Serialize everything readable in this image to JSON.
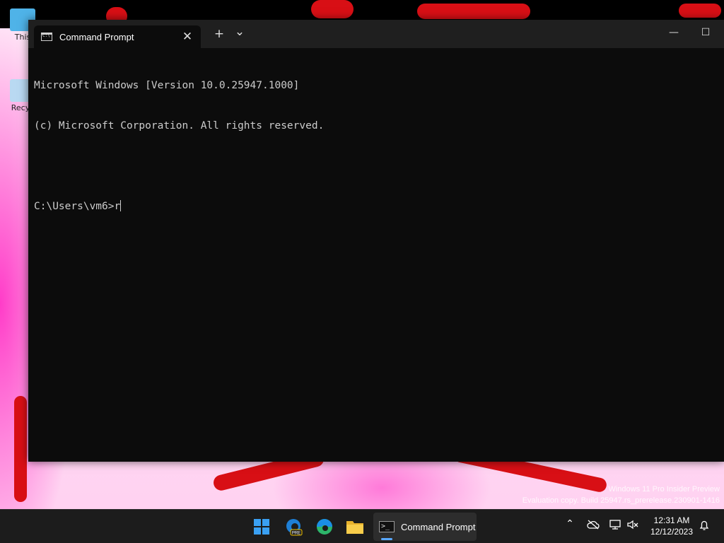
{
  "desktop": {
    "icons": [
      {
        "label": "This"
      },
      {
        "label": "Recyc"
      }
    ],
    "watermark": {
      "line1": "Windows 11 Pro Insider Preview",
      "line2": "Evaluation copy. Build 25947.rs_prerelease.230901-1416"
    }
  },
  "window": {
    "tab": {
      "title": "Command Prompt",
      "icon": "cmd-icon",
      "close_symbol": "✕"
    },
    "new_tab_symbol": "+",
    "dropdown_symbol": "⌄",
    "minimize_symbol": "—",
    "maximize_symbol": "☐",
    "console": {
      "lines": [
        "Microsoft Windows [Version 10.0.25947.1000]",
        "(c) Microsoft Corporation. All rights reserved.",
        "",
        "C:\\Users\\vm6>r"
      ]
    }
  },
  "taskbar": {
    "apps": [
      {
        "name": "start-button",
        "icon": "windows-logo-icon"
      },
      {
        "name": "edge-dev",
        "icon": "edge-pre-icon",
        "badge": "PRE"
      },
      {
        "name": "edge",
        "icon": "edge-icon"
      },
      {
        "name": "file-explorer",
        "icon": "folder-icon"
      }
    ],
    "active_app": {
      "label": "Command Prompt",
      "icon": ">_"
    },
    "tray": {
      "chevron": "⌃",
      "clock_time": "12:31 AM",
      "clock_date": "12/12/2023"
    }
  },
  "colors": {
    "console_bg": "#0c0c0c",
    "console_fg": "#cccccc",
    "titlebar": "#1f1f1f",
    "taskbar": "#1c1c1c",
    "accent": "#3aa0f3"
  }
}
